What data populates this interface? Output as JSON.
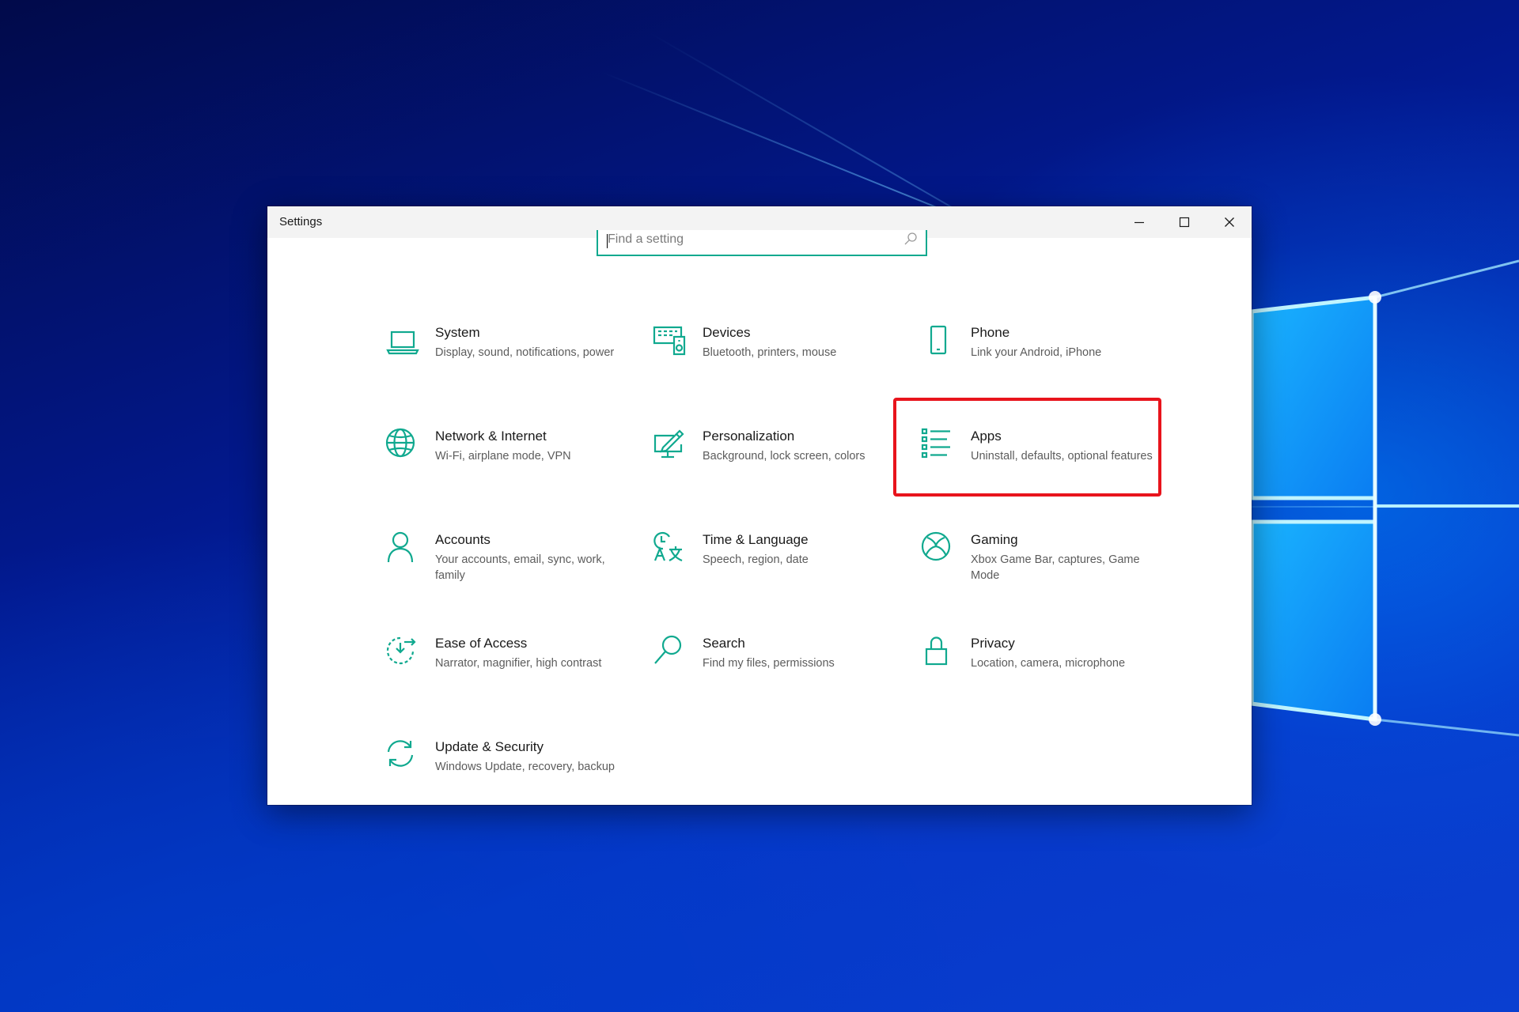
{
  "window": {
    "title": "Settings",
    "minimize_icon": "minimize-icon",
    "maximize_icon": "maximize-icon",
    "close_icon": "close-icon"
  },
  "search": {
    "placeholder": "Find a setting",
    "icon": "search-icon"
  },
  "tiles": [
    {
      "title": "System",
      "description": "Display, sound, notifications, power",
      "icon": "laptop-icon"
    },
    {
      "title": "Devices",
      "description": "Bluetooth, printers, mouse",
      "icon": "devices-icon"
    },
    {
      "title": "Phone",
      "description": "Link your Android, iPhone",
      "icon": "phone-icon"
    },
    {
      "title": "Network & Internet",
      "description": "Wi-Fi, airplane mode, VPN",
      "icon": "globe-icon"
    },
    {
      "title": "Personalization",
      "description": "Background, lock screen, colors",
      "icon": "personalization-icon"
    },
    {
      "title": "Apps",
      "description": "Uninstall, defaults, optional features",
      "icon": "apps-list-icon",
      "highlighted": true
    },
    {
      "title": "Accounts",
      "description": "Your accounts, email, sync, work, family",
      "icon": "person-icon"
    },
    {
      "title": "Time & Language",
      "description": "Speech, region, date",
      "icon": "time-language-icon"
    },
    {
      "title": "Gaming",
      "description": "Xbox Game Bar, captures, Game Mode",
      "icon": "xbox-icon"
    },
    {
      "title": "Ease of Access",
      "description": "Narrator, magnifier, high contrast",
      "icon": "ease-of-access-icon"
    },
    {
      "title": "Search",
      "description": "Find my files, permissions",
      "icon": "magnifier-icon"
    },
    {
      "title": "Privacy",
      "description": "Location, camera, microphone",
      "icon": "lock-icon"
    },
    {
      "title": "Update & Security",
      "description": "Windows Update, recovery, backup",
      "icon": "sync-arrows-icon"
    }
  ],
  "colors": {
    "accent": "#10a98f",
    "highlight": "#e8141c",
    "desktop": "#0637c8"
  }
}
